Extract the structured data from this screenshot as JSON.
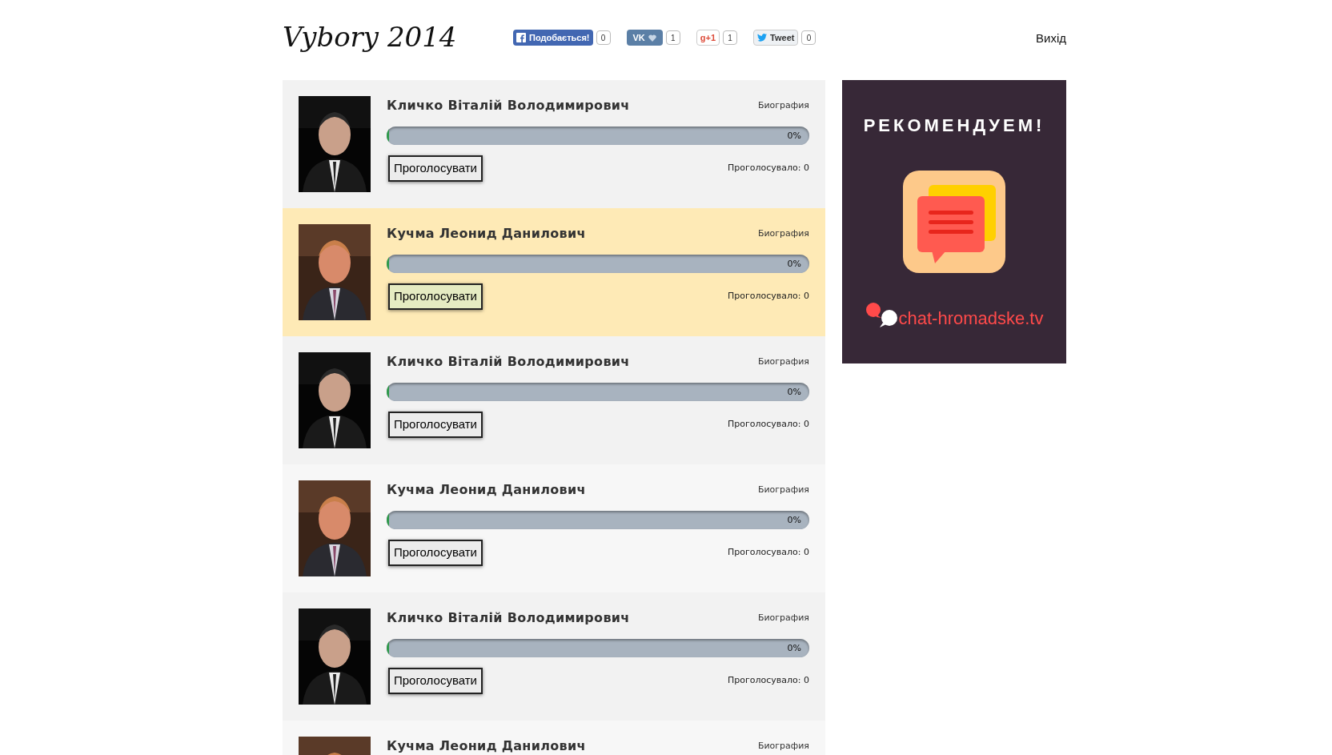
{
  "header": {
    "title": "Vybory 2014",
    "social": [
      {
        "kind": "facebook",
        "label": "Подобається!",
        "count": "0"
      },
      {
        "kind": "vk",
        "label": "VK",
        "count": "1"
      },
      {
        "kind": "gplus",
        "label": "g+1",
        "count": "1"
      },
      {
        "kind": "twitter",
        "label": "Tweet",
        "count": "0"
      }
    ],
    "logout": "Вихід"
  },
  "candidates": [
    {
      "name": "Кличко Віталій Володимирович",
      "bio": "Биография",
      "highlighted": false,
      "level": 0,
      "percent": "0%",
      "vote_button": "Проголосувати",
      "votes": "Проголосувало: 0"
    },
    {
      "name": "Кучма Леонид Данилович",
      "bio": "Биография",
      "highlighted": true,
      "level": 0,
      "percent": "0%",
      "vote_button": "Проголосувати",
      "votes": "Проголосувало: 0"
    },
    {
      "name": "Кличко Віталій Володимирович",
      "bio": "Биография",
      "highlighted": false,
      "level": 0,
      "percent": "0%",
      "vote_button": "Проголосувати",
      "votes": "Проголосувало: 0"
    },
    {
      "name": "Кучма Леонид Данилович",
      "bio": "Биография",
      "highlighted": false,
      "level": 0,
      "percent": "0%",
      "vote_button": "Проголосувати",
      "votes": "Проголосувало: 0"
    },
    {
      "name": "Кличко Віталій Володимирович",
      "bio": "Биография",
      "highlighted": false,
      "level": 0,
      "percent": "0%",
      "vote_button": "Проголосувати",
      "votes": "Проголосувало: 0"
    },
    {
      "name": "Кучма Леонид Данилович",
      "bio": "Биография",
      "highlighted": false
    }
  ],
  "ad": {
    "title": "РЕКОМЕНДУЕМ!",
    "brand": "chat-hromadske.tv"
  }
}
